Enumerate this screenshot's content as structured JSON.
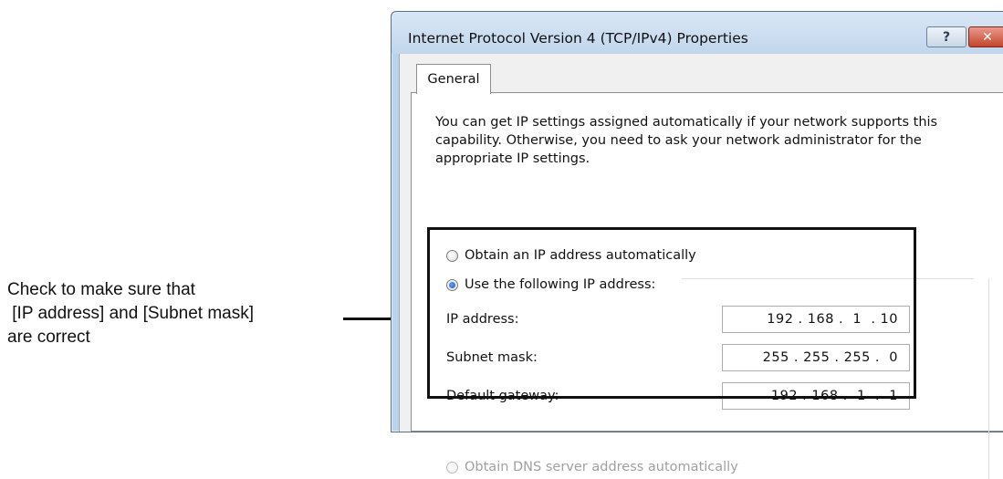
{
  "callout": {
    "text": "Check to make sure that\n [IP address] and [Subnet mask]\nare correct"
  },
  "window": {
    "title": "Internet Protocol Version 4 (TCP/IPv4) Properties",
    "help_label": "?",
    "close_label": "✕"
  },
  "tabs": [
    {
      "label": "General",
      "selected": true
    }
  ],
  "general": {
    "description": "You can get IP settings assigned automatically if your network supports this capability. Otherwise, you need to ask your network administrator for the appropriate IP settings.",
    "option_auto": "Obtain an IP address automatically",
    "option_manual": "Use the following IP address:",
    "selected_option": "manual",
    "fields": [
      {
        "label": "IP address:",
        "value": "192 . 168 .  1  . 10"
      },
      {
        "label": "Subnet mask:",
        "value": "255 . 255 . 255 .  0"
      },
      {
        "label": "Default gateway:",
        "value": "192 . 168 .  1  .  1"
      }
    ],
    "dns_auto": "Obtain DNS server address automatically"
  },
  "colors": {
    "titlebar": "#c1d6ec",
    "close_button": "#c4452d",
    "highlight_border": "#111111"
  }
}
